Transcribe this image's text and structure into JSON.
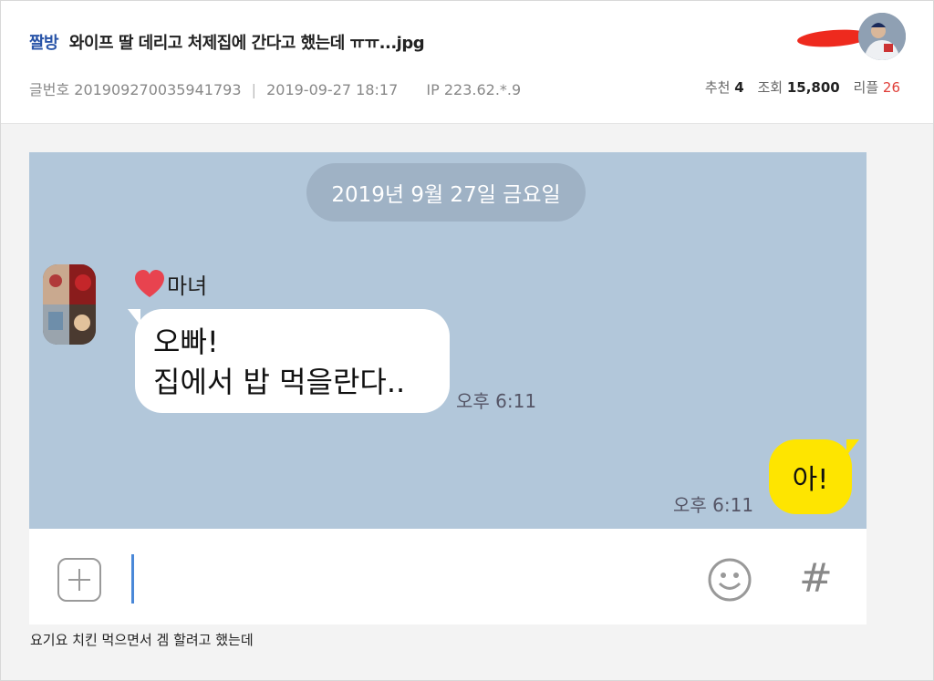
{
  "post": {
    "category": "짤방",
    "title": "와이프 딸 데리고 처제집에 간다고 했는데 ㅠㅠ...jpg",
    "meta": {
      "no_label": "글번호",
      "no_value": "201909270035941793",
      "separator": "|",
      "date": "2019-09-27 18:17",
      "ip_label": "IP",
      "ip_value": "223.62.*.9"
    },
    "stats": {
      "recommend_label": "추천",
      "recommend_value": "4",
      "views_label": "조회",
      "views_value": "15,800",
      "replies_label": "리플",
      "replies_value": "26"
    },
    "caption": "요기요 치킨 먹으면서 겜 할려고 했는데"
  },
  "chat": {
    "date_divider": "2019년 9월 27일 금요일",
    "friend_name": "마녀",
    "received": {
      "line1": "오빠!",
      "line2": "집에서 밥 먹을란다..",
      "time": "오후 6:11"
    },
    "sent": {
      "text": "아!",
      "time": "오후 6:11"
    }
  },
  "input_bar": {
    "hash_symbol": "#"
  },
  "colors": {
    "chat_bg": "#b2c7da",
    "sent_bubble": "#fee500",
    "category": "#2a55a8",
    "replies_count": "#e0403a"
  }
}
